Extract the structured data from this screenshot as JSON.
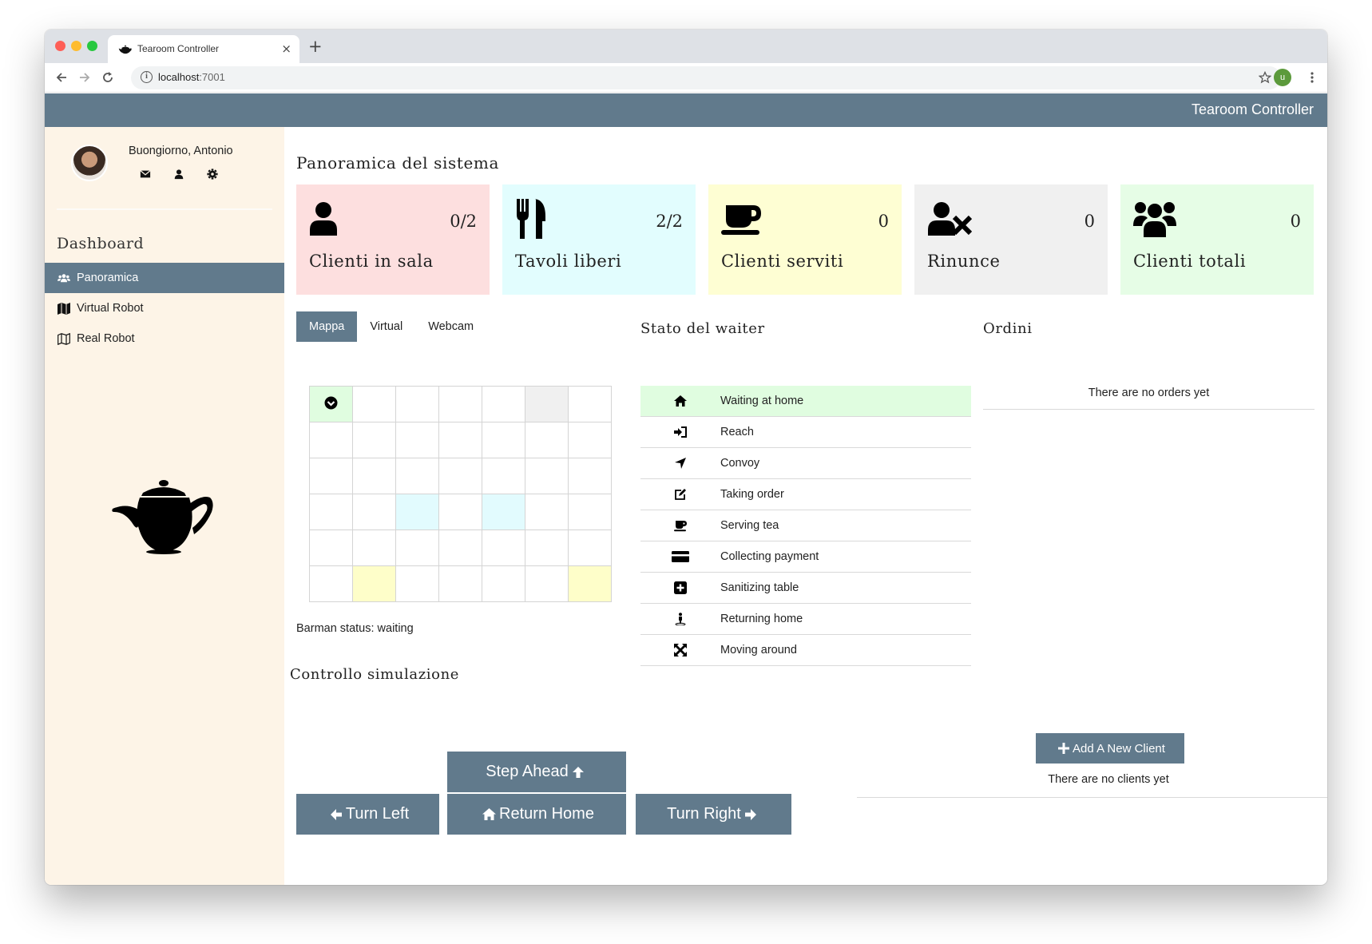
{
  "browser": {
    "tab_title": "Tearoom Controller",
    "new_tab": "+",
    "tab_close": "×",
    "url_host": "localhost",
    "url_port": ":7001",
    "profile_initial": "u"
  },
  "header": {
    "brand": "Tearoom Controller",
    "color": "#617a8c"
  },
  "sidebar": {
    "greeting": "Buongiorno, Antonio",
    "section_title": "Dashboard",
    "items": [
      {
        "label": "Panoramica",
        "icon": "users-icon",
        "active": true
      },
      {
        "label": "Virtual Robot",
        "icon": "map-icon",
        "active": false
      },
      {
        "label": "Real Robot",
        "icon": "map-outline-icon",
        "active": false
      }
    ],
    "background": "#fdf4e7"
  },
  "overview": {
    "title": "Panoramica del sistema",
    "cards": [
      {
        "label": "Clienti in sala",
        "value": "0/2",
        "icon": "user-icon",
        "color": "#fddfdf"
      },
      {
        "label": "Tavoli liberi",
        "value": "2/2",
        "icon": "utensils-icon",
        "color": "#e2fdfe"
      },
      {
        "label": "Clienti serviti",
        "value": "0",
        "icon": "mug-icon",
        "color": "#fefed3"
      },
      {
        "label": "Rinunce",
        "value": "0",
        "icon": "user-times-icon",
        "color": "#f0f0f0"
      },
      {
        "label": "Clienti totali",
        "value": "0",
        "icon": "users-icon",
        "color": "#e6fde6"
      }
    ]
  },
  "view_tabs": [
    {
      "label": "Mappa",
      "active": true
    },
    {
      "label": "Virtual",
      "active": false
    },
    {
      "label": "Webcam",
      "active": false
    }
  ],
  "map": {
    "barman_status": "Barman status: waiting"
  },
  "waiter": {
    "title": "Stato del waiter",
    "states": [
      {
        "label": "Waiting at home",
        "icon": "home-icon",
        "active": true
      },
      {
        "label": "Reach",
        "icon": "sign-in-icon",
        "active": false
      },
      {
        "label": "Convoy",
        "icon": "location-arrow-icon",
        "active": false
      },
      {
        "label": "Taking order",
        "icon": "edit-icon",
        "active": false
      },
      {
        "label": "Serving tea",
        "icon": "mug-icon",
        "active": false
      },
      {
        "label": "Collecting payment",
        "icon": "credit-card-icon",
        "active": false
      },
      {
        "label": "Sanitizing table",
        "icon": "plus-square-icon",
        "active": false
      },
      {
        "label": "Returning home",
        "icon": "person-icon",
        "active": false
      },
      {
        "label": "Moving around",
        "icon": "expand-arrows-icon",
        "active": false
      }
    ]
  },
  "orders": {
    "title": "Ordini",
    "empty": "There are no orders yet"
  },
  "simulation": {
    "title": "Controllo simulazione",
    "step_ahead": "Step Ahead",
    "turn_left": "Turn Left",
    "return_home": "Return Home",
    "turn_right": "Turn Right"
  },
  "clients": {
    "add_button": "Add A New Client",
    "empty": "There are no clients yet"
  }
}
